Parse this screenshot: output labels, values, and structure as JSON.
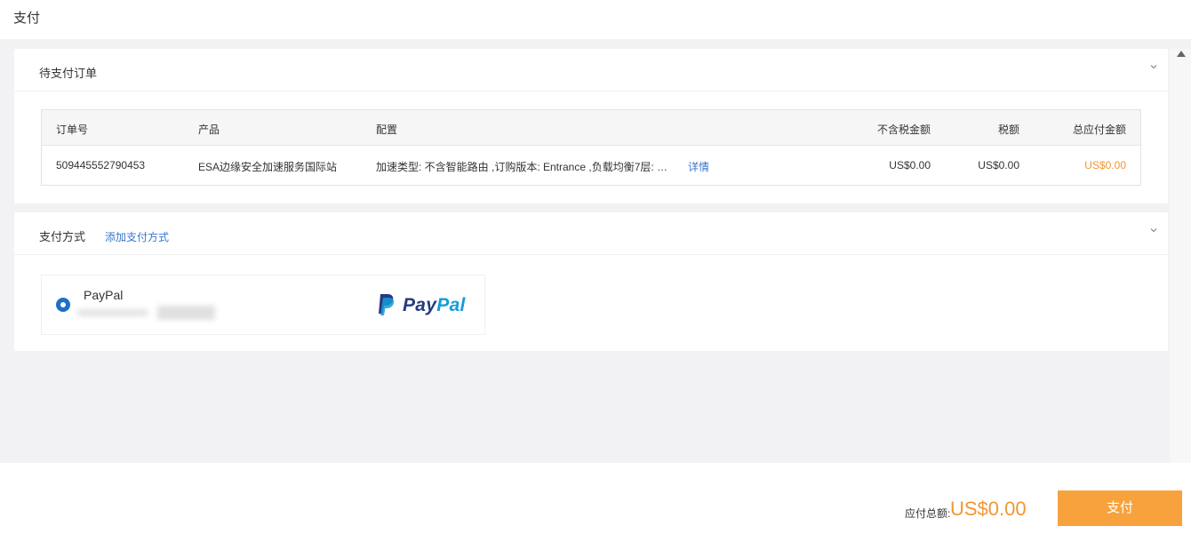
{
  "page": {
    "title": "支付"
  },
  "orders": {
    "title": "待支付订单",
    "columns": {
      "order_no": "订单号",
      "product": "产品",
      "config": "配置",
      "pretax": "不含税金额",
      "tax": "税额",
      "total": "总应付金额"
    },
    "rows": [
      {
        "order_no": "509445552790453",
        "product": "ESA边缘安全加速服务国际站",
        "config": "加速类型: 不含智能路由 ,订购版本: Entrance ,负载均衡7层: 负...",
        "detail_link": "详情",
        "pretax": "US$0.00",
        "tax": "US$0.00",
        "total": "US$0.00"
      }
    ]
  },
  "payment": {
    "title": "支付方式",
    "add_link": "添加支付方式",
    "selected_method": "PayPal",
    "logo": {
      "word1": "Pay",
      "word2": "Pal"
    }
  },
  "footer": {
    "total_label": "应付总额:",
    "total_amount": "US$0.00",
    "pay_button": "支付"
  },
  "colors": {
    "accent_orange": "#f7a23c",
    "amount_orange": "#f29632",
    "link_blue": "#3a76c8",
    "radio_blue": "#1f6fc9",
    "paypal_dark": "#253b80",
    "paypal_light": "#179bd7"
  },
  "icons": [
    "chevron-down-icon",
    "radio-selected-icon",
    "paypal-logo-icon",
    "scroll-up-arrow-icon"
  ]
}
